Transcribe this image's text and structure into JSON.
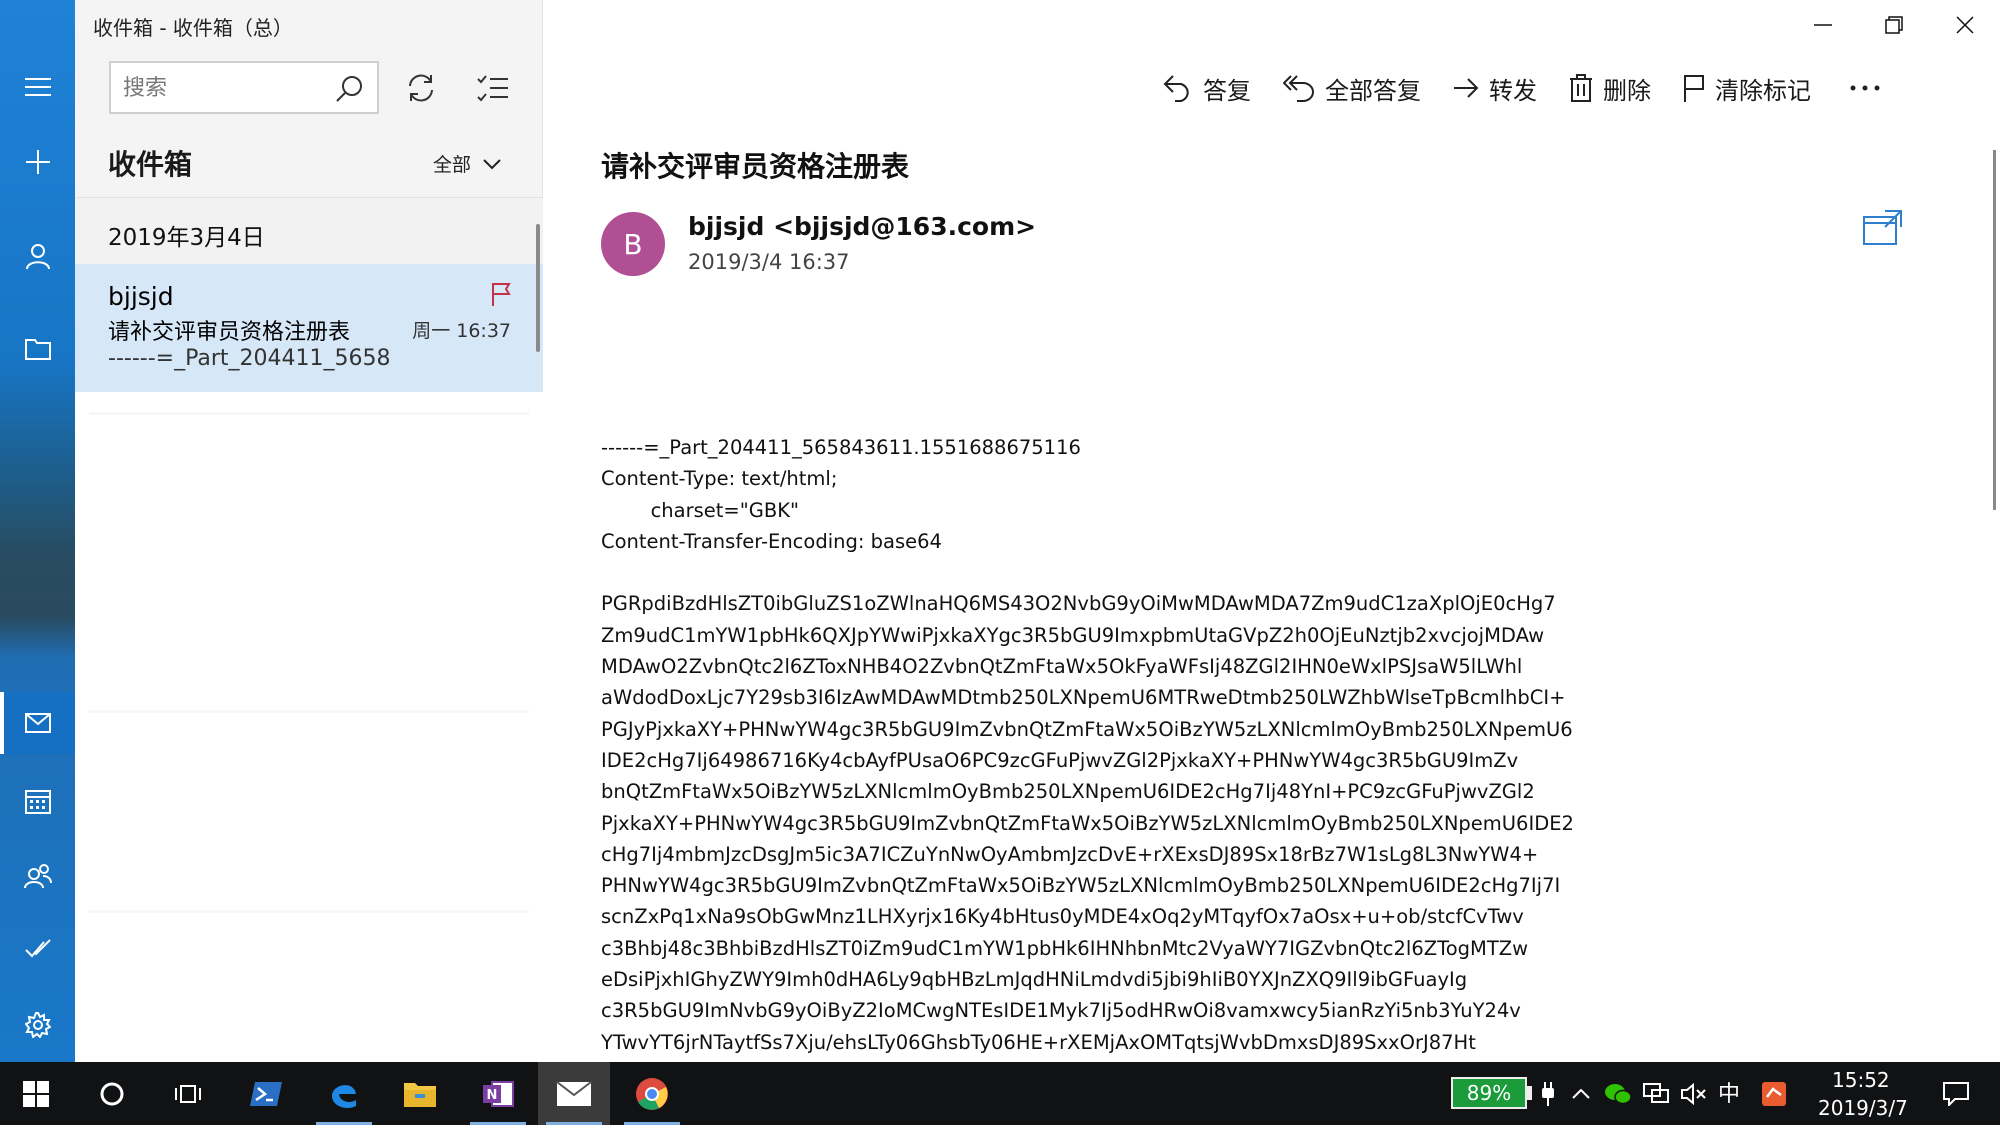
{
  "window": {
    "title": "收件箱 - 收件箱（总）"
  },
  "rail": {
    "items": [
      {
        "icon": "hamburger-icon"
      },
      {
        "icon": "plus-icon"
      },
      {
        "icon": "person-icon"
      },
      {
        "icon": "folder-icon"
      },
      {
        "icon": "mail-icon"
      },
      {
        "icon": "calendar-icon"
      },
      {
        "icon": "people-icon"
      },
      {
        "icon": "todo-icon"
      },
      {
        "icon": "settings-icon"
      }
    ],
    "active_index": 4
  },
  "list": {
    "search_placeholder": "搜索",
    "folder_heading": "收件箱",
    "filter_label": "全部",
    "group_date": "2019年3月4日",
    "messages": [
      {
        "sender": "bjjsjd",
        "subject": "请补交评审员资格注册表",
        "time": "周一 16:37",
        "preview": "------=_Part_204411_5658",
        "flagged": true
      }
    ]
  },
  "toolbar": {
    "reply": "答复",
    "reply_all": "全部答复",
    "forward": "转发",
    "delete": "删除",
    "clear_flag": "清除标记"
  },
  "message": {
    "subject": "请补交评审员资格注册表",
    "avatar_letter": "B",
    "avatar_color": "#b04f94",
    "from": "bjjsjd <bjjsjd@163.com>",
    "date": "2019/3/4 16:37",
    "body": "------=_Part_204411_565843611.1551688675116\nContent-Type: text/html;\n        charset=\"GBK\"\nContent-Transfer-Encoding: base64\n\nPGRpdiBzdHlsZT0ibGluZS1oZWlnaHQ6MS43O2NvbG9yOiMwMDAwMDA7Zm9udC1zaXplOjE0cHg7\nZm9udC1mYW1pbHk6QXJpYWwiPjxkaXYgc3R5bGU9ImxpbmUtaGVpZ2h0OjEuNztjb2xvcjojMDAw\nMDAwO2ZvbnQtc2l6ZToxNHB4O2ZvbnQtZmFtaWx5OkFyaWFsIj48ZGl2IHN0eWxlPSJsaW5lLWhl\naWdodDoxLjc7Y29sb3I6IzAwMDAwMDtmb250LXNpemU6MTRweDtmb250LWZhbWlseTpBcmlhbCI+\nPGJyPjxkaXY+PHNwYW4gc3R5bGU9ImZvbnQtZmFtaWx5OiBzYW5zLXNlcmlmOyBmb250LXNpemU6\nIDE2cHg7Ij64986716Ky4cbAyfPUsaO6PC9zcGFuPjwvZGl2PjxkaXY+PHNwYW4gc3R5bGU9ImZv\nbnQtZmFtaWx5OiBzYW5zLXNlcmlmOyBmb250LXNpemU6IDE2cHg7Ij48YnI+PC9zcGFuPjwvZGl2\nPjxkaXY+PHNwYW4gc3R5bGU9ImZvbnQtZmFtaWx5OiBzYW5zLXNlcmlmOyBmb250LXNpemU6IDE2\ncHg7Ij4mbmJzcDsgJm5ic3A7ICZuYnNwOyAmbmJzcDvE+rXExsDJ89Sx18rBz7W1sLg8L3NwYW4+\nPHNwYW4gc3R5bGU9ImZvbnQtZmFtaWx5OiBzYW5zLXNlcmlmOyBmb250LXNpemU6IDE2cHg7Ij7I\nscnZxPq1xNa9sObGwMnz1LHXyrjx16Ky4bHtus0yMDE4xOq2yMTqyfOx7aOsx+u+ob/stcfCvTwv\nc3Bhbj48c3BhbiBzdHlsZT0iZm9udC1mYW1pbHk6IHNhbnMtc2VyaWY7IGZvbnQtc2l6ZTogMTZw\neDsiPjxhIGhyZWY9Imh0dHA6Ly9qbHBzLmJqdHNiLmdvdi5jbi9hIiB0YXJnZXQ9Il9ibGFuayIg\nc3R5bGU9ImNvbG9yOiByZ2IoMCwgNTEsIDE1Myk7Ij5odHRwOi8vamxwcy5ianRzYi5nb3YuY24v\nYTwvYT6jrNTaytfSs7Xju/ehsLTy06GhsbTy06HE+rXEMjAxOMTqtsjWvbDmxsDJ89SxxOrJ87Ht"
  },
  "taskbar": {
    "battery": "89%",
    "ime": "中",
    "time": "15:52",
    "date": "2019/3/7",
    "battery_color": "#1b9b3a"
  }
}
